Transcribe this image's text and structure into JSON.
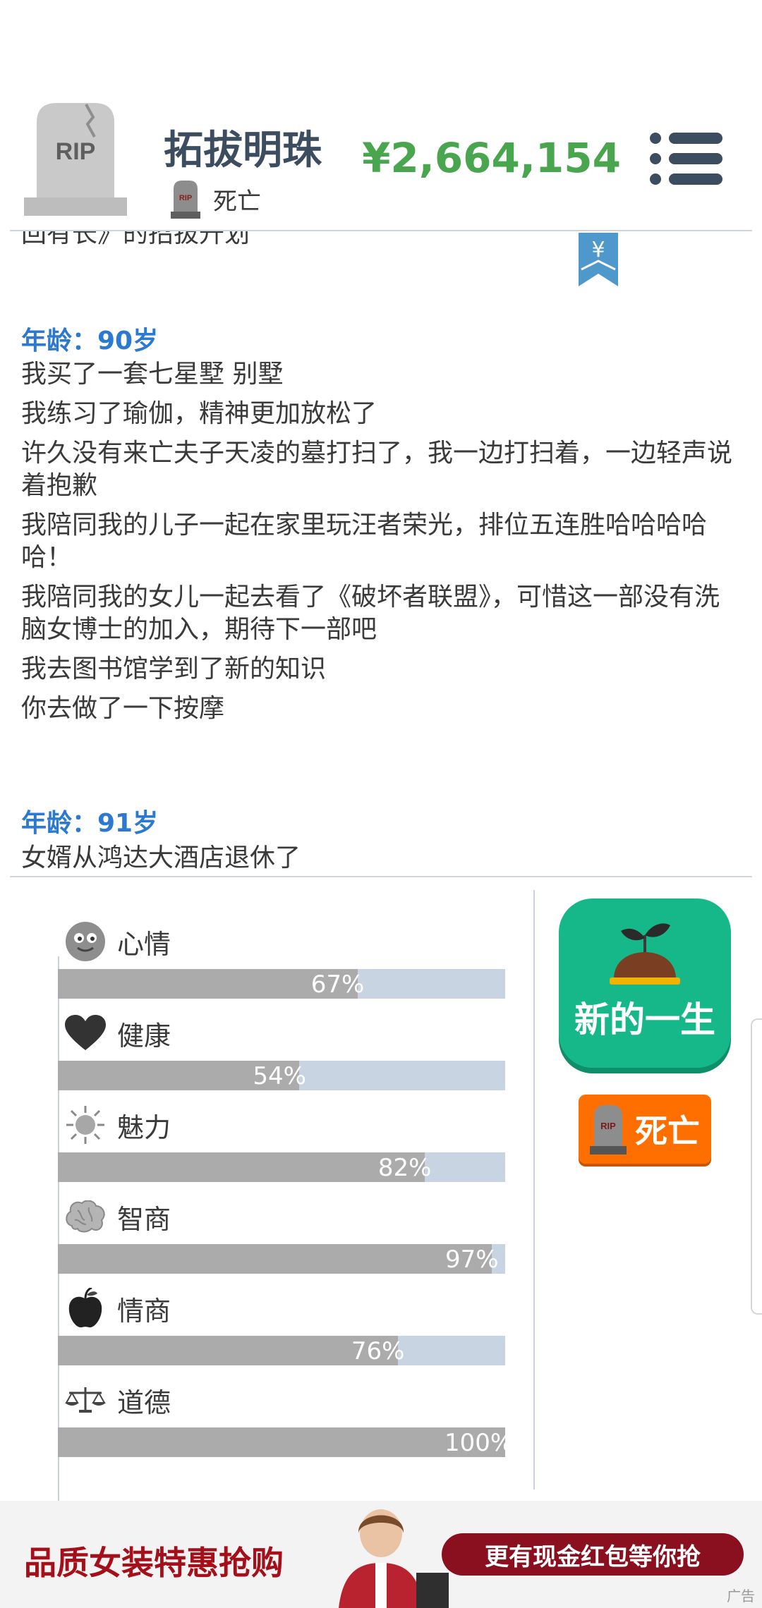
{
  "header": {
    "name": "拓拔明珠",
    "status": "死亡",
    "money": "¥2,664,154"
  },
  "log": {
    "cut_top_line": "回有长》的招拔升划",
    "sections": [
      {
        "age": "年龄：90岁",
        "entries": [
          "我买了一套七星墅 别墅",
          "我练习了瑜伽，精神更加放松了",
          "许久没有来亡夫子天凌的墓打扫了，我一边打扫着，一边轻声说着抱歉",
          "我陪同我的儿子一起在家里玩汪者荣光，排位五连胜哈哈哈哈哈！",
          "我陪同我的女儿一起去看了《破坏者联盟》，可惜这一部没有洗脑女博士的加入，期待下一部吧",
          "我去图书馆学到了新的知识",
          "你去做了一下按摩"
        ]
      },
      {
        "age": "年龄：91岁",
        "entries": [
          "女婿从鸿达大酒店退休了"
        ]
      }
    ]
  },
  "stats": [
    {
      "label": "心情",
      "percent": 67,
      "percent_text": "67%",
      "icon": "smiley-face-icon"
    },
    {
      "label": "健康",
      "percent": 54,
      "percent_text": "54%",
      "icon": "heart-icon"
    },
    {
      "label": "魅力",
      "percent": 82,
      "percent_text": "82%",
      "icon": "sun-icon"
    },
    {
      "label": "智商",
      "percent": 97,
      "percent_text": "97%",
      "icon": "brain-icon"
    },
    {
      "label": "情商",
      "percent": 76,
      "percent_text": "76%",
      "icon": "apple-icon"
    },
    {
      "label": "道德",
      "percent": 100,
      "percent_text": "100%",
      "icon": "scales-icon"
    }
  ],
  "buttons": {
    "new_life": "新的一生",
    "death": "死亡"
  },
  "ad": {
    "left_text": "品质女装特惠抢购",
    "pill_text": "更有现金红包等你抢",
    "tag": "广告"
  },
  "colors": {
    "age_blue": "#2b79d0",
    "money_green": "#4aa64e",
    "bar_fill": "#ababab",
    "bar_track": "#c8d4e1",
    "new_life_green": "#16b88a",
    "death_orange": "#ff6f00"
  }
}
